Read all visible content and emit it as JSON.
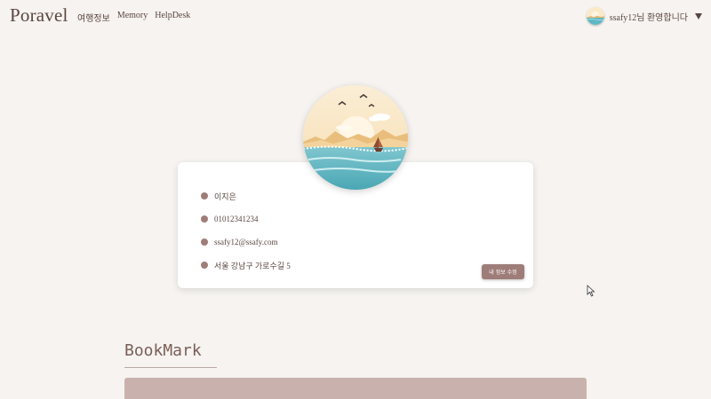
{
  "nav": {
    "brand": "Poravel",
    "links": [
      "여행정보",
      "Memory",
      "HelpDesk"
    ],
    "welcome": "ssafy12님 환영합니다"
  },
  "profile": {
    "name": "이지은",
    "phone": "01012341234",
    "email": "ssafy12@ssafy.com",
    "address": "서울 강남구 가로수길 5",
    "edit_button": "내 정보 수정"
  },
  "bookmark": {
    "title": "BookMark"
  },
  "colors": {
    "background": "#f6f3f0",
    "accent": "#9e7d79",
    "text": "#5a4640",
    "panel": "#c9b2ae"
  }
}
